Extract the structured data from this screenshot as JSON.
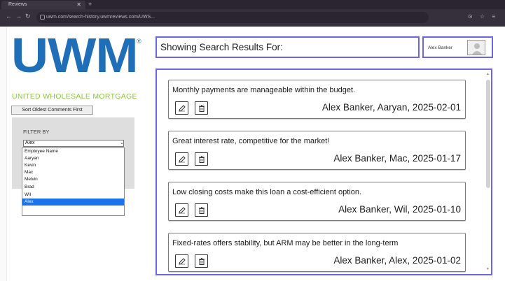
{
  "browser": {
    "tab_title": "Reviews",
    "url": "uwm.com/search-history.uwmreviews.com/UWS..."
  },
  "logo": {
    "wordmark": "UWM",
    "registered": "®",
    "tagline": "UNITED WHOLESALE MORTGAGE"
  },
  "sidebar": {
    "sort_label": "Sort Oldest Comments First",
    "filter_label": "FILTER BY",
    "selected": "Alex",
    "options": [
      "Employee Name",
      "Aaryan",
      "Kevin",
      "Mac",
      "Melvin",
      "Brad",
      "Wil",
      "Alex"
    ]
  },
  "header": {
    "title": "Showing Search Results For:",
    "user_name": "Alex Banker"
  },
  "results": [
    {
      "comment": "Monthly payments are manageable within the budget.",
      "meta": "Alex Banker, Aaryan, 2025-02-01"
    },
    {
      "comment": "Great interest rate, competitive for the market!",
      "meta": "Alex Banker, Mac, 2025-01-17"
    },
    {
      "comment": "Low closing costs make this loan a cost-efficient option.",
      "meta": "Alex Banker, Wil, 2025-01-10"
    },
    {
      "comment": "Fixed-rates offers stability, but ARM may be better in the long-term",
      "meta": "Alex Banker, Alex, 2025-01-02"
    }
  ],
  "colors": {
    "accent_border": "#6b66e8",
    "brand_blue": "#1f6fb8",
    "brand_green": "#8cc63f",
    "dropdown_selected": "#1a73e8"
  },
  "icons": {
    "edit": "edit-icon",
    "delete": "trash-icon",
    "avatar": "user-avatar-icon"
  }
}
